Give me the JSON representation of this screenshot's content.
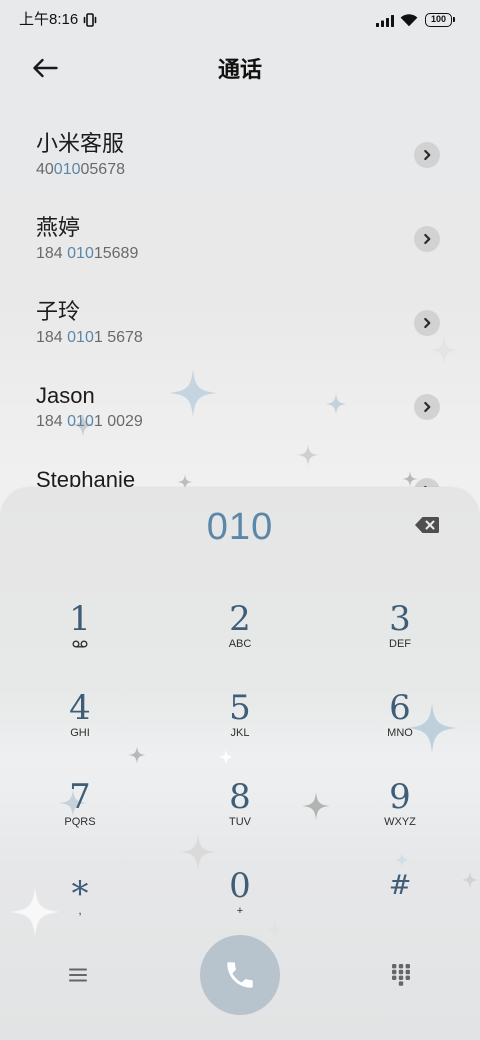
{
  "status_bar": {
    "time": "上午8:16",
    "battery": "100",
    "icons": [
      "vibrate-icon",
      "signal-icon",
      "wifi-icon",
      "battery-icon"
    ]
  },
  "header": {
    "back_icon": "back-arrow-icon",
    "title": "通话"
  },
  "contacts": [
    {
      "name": "小米客服",
      "number": {
        "before": "40",
        "match": "010",
        "after": "05678"
      },
      "action_icon": "chevron-right-icon"
    },
    {
      "name": "燕婷",
      "number": {
        "before": "184 ",
        "match": "010",
        "after": "15689"
      },
      "action_icon": "chevron-right-icon"
    },
    {
      "name": "子玲",
      "number": {
        "before": "184 ",
        "match": "010",
        "after": "1 5678"
      },
      "action_icon": "chevron-right-icon"
    },
    {
      "name": "Jason",
      "number": {
        "before": "184 ",
        "match": "010",
        "after": "1 0029"
      },
      "action_icon": "chevron-right-icon"
    },
    {
      "name": "Stephanie",
      "action_icon": "chevron-right-icon"
    }
  ],
  "dialer": {
    "input": "010",
    "backspace_icon": "backspace-icon",
    "keys": [
      {
        "digit": "1",
        "sub_icon": "voicemail-icon"
      },
      {
        "digit": "2",
        "sub": "ABC"
      },
      {
        "digit": "3",
        "sub": "DEF"
      },
      {
        "digit": "4",
        "sub": "GHI"
      },
      {
        "digit": "5",
        "sub": "JKL"
      },
      {
        "digit": "6",
        "sub": "MNO"
      },
      {
        "digit": "7",
        "sub": "PQRS"
      },
      {
        "digit": "8",
        "sub": "TUV"
      },
      {
        "digit": "9",
        "sub": "WXYZ"
      },
      {
        "digit": "*",
        "sub": ","
      },
      {
        "digit": "0",
        "sub": "+"
      },
      {
        "digit": "#"
      }
    ],
    "bottom_bar": {
      "left_icon": "menu-icon",
      "center_icon": "phone-icon",
      "right_icon": "dialpad-icon"
    }
  },
  "colors": {
    "background": "#e9e9ea",
    "text_primary": "#1c1c1c",
    "text_secondary": "#6a6a6a",
    "match_highlight": "#5b87a8",
    "key_digit": "#3e5d77",
    "call_button": "#b7c4ce",
    "chevron_button": "#d2d2d2"
  }
}
